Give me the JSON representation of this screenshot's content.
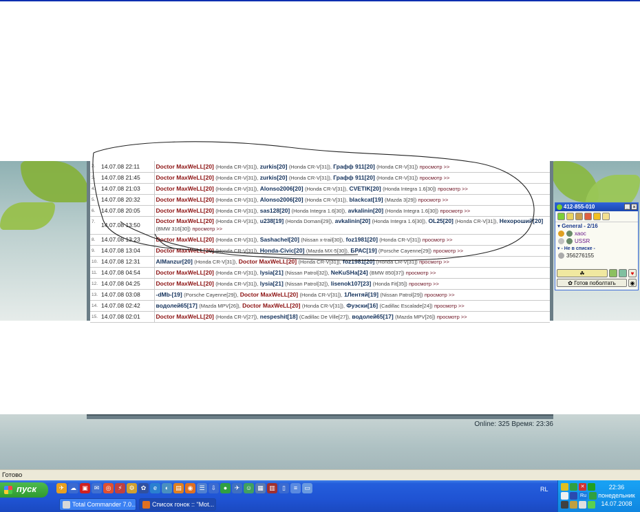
{
  "races": [
    {
      "num": "2.",
      "date": "14.07.08 22:11",
      "parts": [
        {
          "p": "Doctor MaxWeLL[20]",
          "hi": true,
          "c": "(Honda CR-V[31]),"
        },
        {
          "p": "zurkis[20]",
          "c": "(Honda CR-V[31]),"
        },
        {
          "p": "Графф 911[20]",
          "c": "(Honda CR-V[31])"
        }
      ],
      "view": "просмотр >>"
    },
    {
      "num": "3.",
      "date": "14.07.08 21:45",
      "parts": [
        {
          "p": "Doctor MaxWeLL[20]",
          "hi": true,
          "c": "(Honda CR-V[31]),"
        },
        {
          "p": "zurkis[20]",
          "c": "(Honda CR-V[31]),"
        },
        {
          "p": "Графф 911[20]",
          "c": "(Honda CR-V[31])"
        }
      ],
      "view": "просмотр >>"
    },
    {
      "num": "4.",
      "date": "14.07.08 21:03",
      "parts": [
        {
          "p": "Doctor MaxWeLL[20]",
          "hi": true,
          "c": "(Honda CR-V[31]),"
        },
        {
          "p": "Alonso2006[20]",
          "c": "(Honda CR-V[31]),"
        },
        {
          "p": "CVETIK[20]",
          "c": "(Honda Integra 1.6[30])"
        }
      ],
      "view": "просмотр >>"
    },
    {
      "num": "5.",
      "date": "14.07.08 20:32",
      "parts": [
        {
          "p": "Doctor MaxWeLL[20]",
          "hi": true,
          "c": "(Honda CR-V[31]),"
        },
        {
          "p": "Alonso2006[20]",
          "c": "(Honda CR-V[31]),"
        },
        {
          "p": "blackcat[19]",
          "c": "(Mazda 3[29])"
        }
      ],
      "view": "просмотр >>"
    },
    {
      "num": "6.",
      "date": "14.07.08 20:05",
      "parts": [
        {
          "p": "Doctor MaxWeLL[20]",
          "hi": true,
          "c": "(Honda CR-V[31]),"
        },
        {
          "p": "sas128[20]",
          "c": "(Honda Integra 1.6[30]),"
        },
        {
          "p": "avkalinin[20]",
          "c": "(Honda Integra 1.6[30])"
        }
      ],
      "view": "просмотр >>"
    },
    {
      "num": "7.",
      "date": "14.07.08 13:50",
      "parts": [
        {
          "p": "Doctor MaxWeLL[20]",
          "hi": true,
          "c": "(Honda CR-V[31]),"
        },
        {
          "p": "u238[19]",
          "c": "(Honda Domani[29]),"
        },
        {
          "p": "avkalinin[20]",
          "c": "(Honda Integra 1.6[30]),"
        },
        {
          "p": "OL25[20]",
          "c": "(Honda CR-V[31]),"
        },
        {
          "p": "Нехороший[20]",
          "c": "(BMW 316[30])"
        }
      ],
      "view": "просмотр >>",
      "tall": true
    },
    {
      "num": "8.",
      "date": "14.07.08 13:23",
      "parts": [
        {
          "p": "Doctor MaxWeLL[20]",
          "hi": true,
          "c": "(Honda CR-V[31]),"
        },
        {
          "p": "Sashachel[20]",
          "c": "(Nissan x-trail[30]),"
        },
        {
          "p": "foz1981[20]",
          "c": "(Honda CR-V[31])"
        }
      ],
      "view": "просмотр >>"
    },
    {
      "num": "9.",
      "date": "14.07.08 13:04",
      "parts": [
        {
          "p": "Doctor MaxWeLL[20]",
          "hi": true,
          "c": "(Honda CR-V[31]),"
        },
        {
          "p": "Honda-Civic[20]",
          "c": "(Mazda MX-5[30]),"
        },
        {
          "p": "БРАС[19]",
          "c": "(Porsche Cayenne[29])"
        }
      ],
      "view": "просмотр >>"
    },
    {
      "num": "10.",
      "date": "14.07.08 12:31",
      "parts": [
        {
          "p": "AlManzur[20]",
          "c": "(Honda CR-V[31]),"
        },
        {
          "p": "Doctor MaxWeLL[20]",
          "hi": true,
          "c": "(Honda CR-V[31]),"
        },
        {
          "p": "foz1981[20]",
          "c": "(Honda CR-V[31])"
        }
      ],
      "view": "просмотр >>"
    },
    {
      "num": "11.",
      "date": "14.07.08 04:54",
      "parts": [
        {
          "p": "Doctor MaxWeLL[20]",
          "hi": true,
          "c": "(Honda CR-V[31]),"
        },
        {
          "p": "lysia[21]",
          "c": "(Nissan Patrol[32]),"
        },
        {
          "p": "NeKuSHa[24]",
          "c": "(BMW 850[37])"
        }
      ],
      "view": "просмотр >>"
    },
    {
      "num": "12.",
      "date": "14.07.08 04:25",
      "parts": [
        {
          "p": "Doctor MaxWeLL[20]",
          "hi": true,
          "c": "(Honda CR-V[31]),"
        },
        {
          "p": "lysia[21]",
          "c": "(Nissan Patrol[32]),"
        },
        {
          "p": "lisenok107[23]",
          "c": "(Honda Fit[35])"
        }
      ],
      "view": "просмотр >>"
    },
    {
      "num": "13.",
      "date": "14.07.08 03:08",
      "parts": [
        {
          "p": "-dMb-[19]",
          "c": "(Porsche Cayenne[29]),"
        },
        {
          "p": "Doctor MaxWeLL[20]",
          "hi": true,
          "c": "(Honda CR-V[31]),"
        },
        {
          "p": "1Лентяй[19]",
          "c": "(Nissan Patrol[29])"
        }
      ],
      "view": "просмотр >>"
    },
    {
      "num": "14.",
      "date": "14.07.08 02:42",
      "parts": [
        {
          "p": "водолей65[17]",
          "c": "(Mazda MPV[26]),"
        },
        {
          "p": "Doctor MaxWeLL[20]",
          "hi": true,
          "c": "(Honda CR-V[31]),"
        },
        {
          "p": "Фуэски[16]",
          "c": "(Cadillac Escalade[24])"
        }
      ],
      "view": "просмотр >>"
    },
    {
      "num": "15.",
      "date": "14.07.08 02:01",
      "parts": [
        {
          "p": "Doctor MaxWeLL[20]",
          "hi": true,
          "c": "(Honda CR-V[27]),"
        },
        {
          "p": "nespeshit[18]",
          "c": "(Cadillac De Ville[27]),"
        },
        {
          "p": "водолей65[17]",
          "c": "(Mazda MPV[26])"
        }
      ],
      "view": "просмотр >>"
    }
  ],
  "footer": {
    "stats": "Online: 325  Время: 23:36"
  },
  "statusbar": {
    "text": "Готово"
  },
  "icq": {
    "uin": "412-855-010",
    "group": "General - 2/16",
    "contacts": [
      "хаос",
      "USSR"
    ],
    "not_in_list": "- Не в списке -",
    "extra_uin": "356276155",
    "status_button": "Готов поболтать"
  },
  "taskbar": {
    "start_label": "пуск",
    "tasks": [
      "Total Commander 7.0...",
      "Список гонок :: \"Mot..."
    ],
    "lang": "RL",
    "tray_lang": "Ru",
    "time": "22:36",
    "weekday": "понедельник",
    "date": "14.07.2008"
  },
  "colors": {
    "taskbar": "#245edc",
    "start": "#2f9a2f",
    "tray": "#0f86e0",
    "player_highlight": "#8b1010",
    "player": "#12305a",
    "view_link": "#6b1020"
  }
}
